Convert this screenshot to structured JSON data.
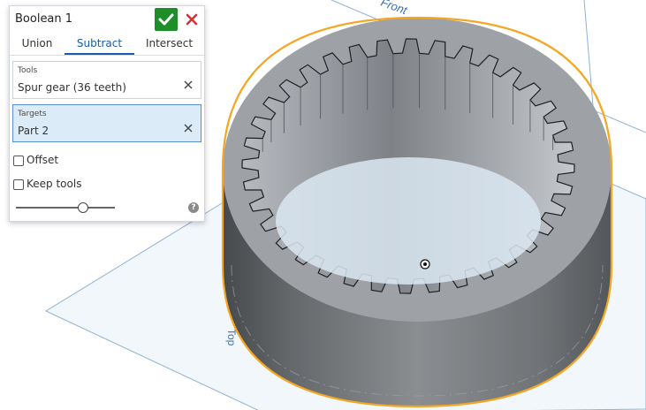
{
  "dialog": {
    "title": "Boolean 1",
    "tabs": [
      {
        "label": "Union",
        "active": false
      },
      {
        "label": "Subtract",
        "active": true
      },
      {
        "label": "Intersect",
        "active": false
      }
    ],
    "tools": {
      "label": "Tools",
      "value": "Spur gear (36 teeth)"
    },
    "targets": {
      "label": "Targets",
      "value": "Part 2"
    },
    "offset": {
      "label": "Offset",
      "checked": false
    },
    "keep_tools": {
      "label": "Keep tools",
      "checked": false
    },
    "slider": {
      "level": 0.68
    },
    "help_glyph": "?"
  },
  "viewport": {
    "plane_label_top": "Front",
    "plane_label_left": "Top",
    "gear_teeth": 36,
    "colors": {
      "selection_outline": "#f5a623",
      "plane_edge": "#8fb2d6",
      "plane_fill": "#dce9f7",
      "part_body": "#7f8387",
      "ok_button": "#1e8e2a",
      "cancel_icon": "#d0343a",
      "active_tab": "#1a5caa"
    }
  }
}
